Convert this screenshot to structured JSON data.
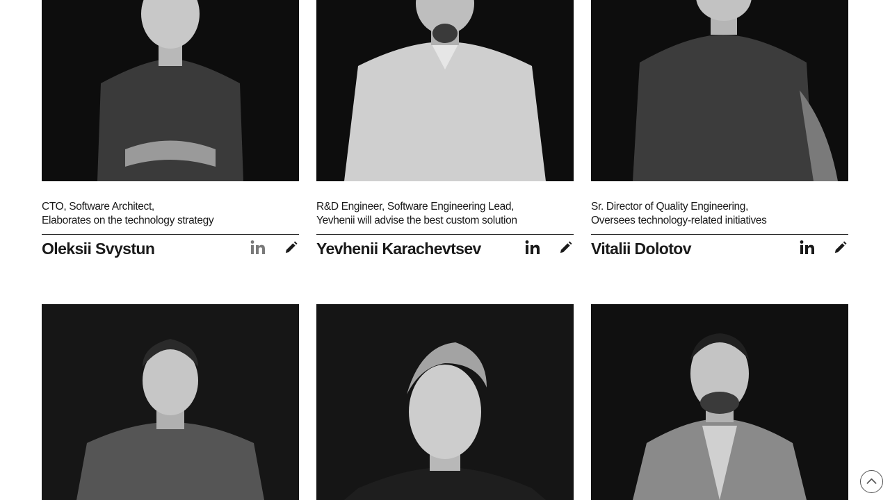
{
  "team": [
    {
      "role_line1": "CTO, Software Architect,",
      "role_line2": "Elaborates on the technology strategy",
      "name": "Oleksii Svystun",
      "shirt": "#3a3a3a",
      "linkedin_icon": "linkedin-icon",
      "edit_icon": "pencil-icon"
    },
    {
      "role_line1": "R&D Engineer, Software Engineering Lead,",
      "role_line2": "Yevhenii will advise the best custom solution",
      "name": "Yevhenii Karachevtsev",
      "shirt": "#cfcfcf",
      "linkedin_icon": "linkedin-icon",
      "edit_icon": "pencil-icon"
    },
    {
      "role_line1": "Sr. Director of Quality Engineering,",
      "role_line2": "Oversees technology-related initiatives",
      "name": "Vitalii Dolotov",
      "shirt": "#3c3c3c",
      "linkedin_icon": "linkedin-icon",
      "edit_icon": "pencil-icon"
    },
    {
      "shirt": "#555555"
    },
    {
      "shirt": "#1e1e1e"
    },
    {
      "shirt": "#8a8a8a"
    }
  ],
  "colors": {
    "photo_bg": "#0d0d0d",
    "text": "#1a1a1a",
    "icon_linkedin_muted": "#7a7a7a",
    "page_bg": "#ffffff"
  },
  "scroll_top_icon": "chevron-up-circle-icon"
}
